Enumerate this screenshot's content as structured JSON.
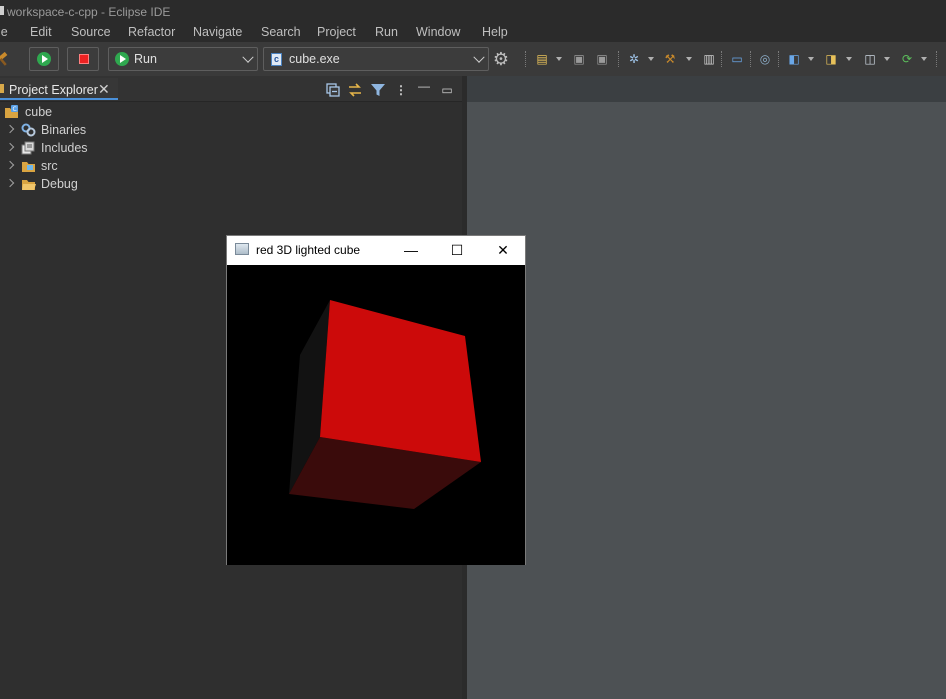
{
  "window": {
    "title": "workspace-c-cpp - Eclipse IDE"
  },
  "menu": [
    "File",
    "Edit",
    "Source",
    "Refactor",
    "Navigate",
    "Search",
    "Project",
    "Run",
    "Window",
    "Help"
  ],
  "menu_visible": [
    "le",
    "Edit",
    "Source",
    "Refactor",
    "Navigate",
    "Search",
    "Project",
    "Run",
    "Window",
    "Help"
  ],
  "toolbar": {
    "launch_mode": "Run",
    "launch_target": "cube.exe"
  },
  "explorer": {
    "tab_label": "Project Explorer",
    "project": "cube",
    "children": [
      "Binaries",
      "Includes",
      "src",
      "Debug"
    ]
  },
  "glut_window": {
    "title": "red 3D lighted cube",
    "minimize_symbol": "—",
    "maximize_symbol": "☐",
    "close_symbol": "✕"
  },
  "colors": {
    "cube_front": "#cc0a0a",
    "cube_bottom": "#3a0b0b",
    "cube_side": "#121212",
    "canvas_bg": "#000000",
    "editor_bg": "#4d5154",
    "tab_accent": "#4a90d9"
  }
}
